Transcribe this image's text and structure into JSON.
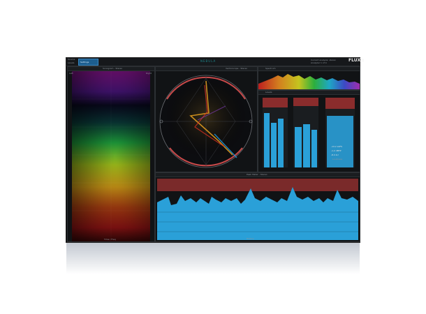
{
  "app": {
    "top_left_labels": [
      "Source",
      "Levels"
    ],
    "mode_button": "Settings",
    "brand_text": "NEBULA",
    "logo": "FLUX::",
    "status_line_1": "Current analysis: stereo",
    "status_line_2": "Analyzer 1 of 4"
  },
  "panels": {
    "spectrogram": {
      "title": "Sonogram - Stereo",
      "footer": "Time / Freq",
      "left_label": "Left",
      "right_label": "Right"
    },
    "vectorscope": {
      "title": "Vectorscope - Stereo"
    },
    "spectrum": {
      "title": "Spectrum"
    },
    "meters": {
      "title": "Levels",
      "readout_1": "-13.2 LUFS",
      "readout_2": "-1.2 dBTP",
      "readout_3": "-8.4 LU",
      "readout_label": "Loudness"
    },
    "waveform": {
      "title": "Peak Meter - Stereo",
      "footer": "History"
    }
  },
  "colors": {
    "accent": "#1d5e8f",
    "brand": "#1e8a8f",
    "waveform": "#2aa0d8",
    "clip": "#8a2c2c"
  }
}
